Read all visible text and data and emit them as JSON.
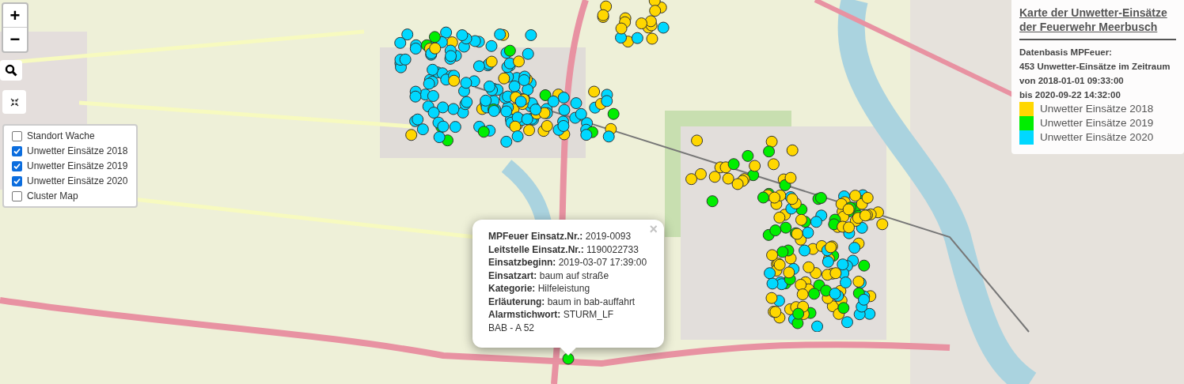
{
  "zoom_controls": [
    "+",
    "−"
  ],
  "layers": [
    {
      "label": "Standort Wache",
      "checked": false
    },
    {
      "label": "Unwetter Einsätze 2018",
      "checked": true
    },
    {
      "label": "Unwetter Einsätze 2019",
      "checked": true
    },
    {
      "label": "Unwetter Einsätze 2020",
      "checked": true
    },
    {
      "label": "Cluster Map",
      "checked": false
    }
  ],
  "legend": {
    "title_lines": [
      "Karte der Unwetter-Einsätze",
      "der Feuerwehr Meerbusch"
    ],
    "info_lines": [
      "Datenbasis MPFeuer:",
      "453 Unwetter-Einsätze im Zeitraum",
      "von 2018-01-01 09:33:00",
      "bis 2020-09-22 14:32:00"
    ],
    "items": [
      {
        "label": "Unwetter Einsätze 2018",
        "color": "#ffd700"
      },
      {
        "label": "Unwetter Einsätze 2019",
        "color": "#00ee00"
      },
      {
        "label": "Unwetter Einsätze 2020",
        "color": "#00d8ff"
      }
    ]
  },
  "popup": {
    "close": "×",
    "fields": [
      {
        "label": "MPFeuer Einsatz.Nr.:",
        "value": "2019-0093"
      },
      {
        "label": "Leitstelle Einsatz.Nr.:",
        "value": "1190022733"
      },
      {
        "label": "Einsatzbeginn:",
        "value": "2019-03-07 17:39:00"
      },
      {
        "label": "Einsatzart:",
        "value": "baum auf straße"
      },
      {
        "label": "Kategorie:",
        "value": "Hilfeleistung"
      },
      {
        "label": "Erläuterung:",
        "value": "baum in bab-auffahrt"
      },
      {
        "label": "Alarmstichwort:",
        "value": "STURM_LF"
      }
    ],
    "note": "BAB - A 52"
  }
}
